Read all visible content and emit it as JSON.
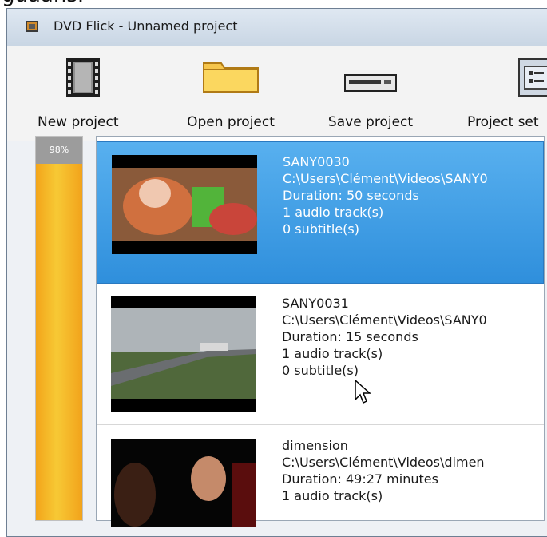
{
  "caption": "guaans.",
  "window": {
    "title": "DVD Flick - Unnamed project"
  },
  "toolbar": {
    "new_project": "New project",
    "open_project": "Open project",
    "save_project": "Save project",
    "project_settings": "Project set"
  },
  "sidebar": {
    "percent_label": "98%",
    "fill_fraction": 0.98
  },
  "items": [
    {
      "name": "SANY0030",
      "path": "C:\\Users\\Clément\\Videos\\SANY0",
      "duration": "Duration: 50 seconds",
      "audio": "1 audio track(s)",
      "subtitles": "0 subtitle(s)"
    },
    {
      "name": "SANY0031",
      "path": "C:\\Users\\Clément\\Videos\\SANY0",
      "duration": "Duration: 15 seconds",
      "audio": "1 audio track(s)",
      "subtitles": "0 subtitle(s)"
    },
    {
      "name": "dimension",
      "path": "C:\\Users\\Clément\\Videos\\dimen",
      "duration": "Duration: 49:27 minutes",
      "audio": "1 audio track(s)"
    }
  ],
  "icons": {
    "app": "dvd-flick-icon",
    "new_project": "film-strip-icon",
    "open_project": "folder-icon",
    "save_project": "drive-icon",
    "project_settings": "settings-panel-icon",
    "cursor": "mouse-pointer-icon"
  }
}
